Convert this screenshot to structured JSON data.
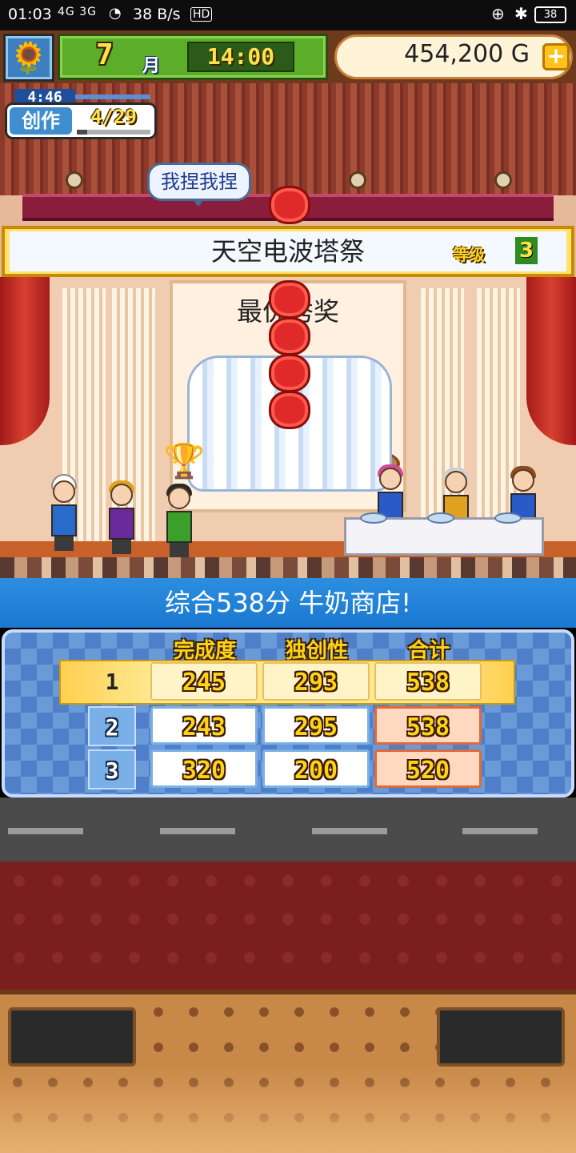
{
  "status_bar": {
    "time": "01:03",
    "signal": "4G 3G",
    "net_speed": "38 B/s",
    "hd": "HD",
    "battery": "38"
  },
  "hud": {
    "month_number": "7",
    "month_label": "月",
    "clock": "14:00",
    "gold": "454,200 G",
    "plus": "+"
  },
  "creation": {
    "timer": "4:46",
    "label": "创作",
    "count": "4/29",
    "progress": 0.14
  },
  "speech_bubble": "我捏我捏",
  "event": {
    "title": "天空电波塔祭",
    "grade_label": "等级",
    "grade_value": "3"
  },
  "award": {
    "title": "最优秀奖"
  },
  "score_summary": "综合538分 牛奶商店!",
  "score_table": {
    "columns": [
      "完成度",
      "独创性",
      "合计"
    ],
    "rows": [
      {
        "rank": "1",
        "completion": "245",
        "originality": "293",
        "total": "538"
      },
      {
        "rank": "2",
        "completion": "243",
        "originality": "295",
        "total": "538"
      },
      {
        "rank": "3",
        "completion": "320",
        "originality": "200",
        "total": "520"
      }
    ]
  },
  "colors": {
    "score_header": "#1a78d0",
    "gold_text": "#ffd21a",
    "curtain_red": "#a41a1a",
    "grade_green": "#2f8a1f"
  }
}
